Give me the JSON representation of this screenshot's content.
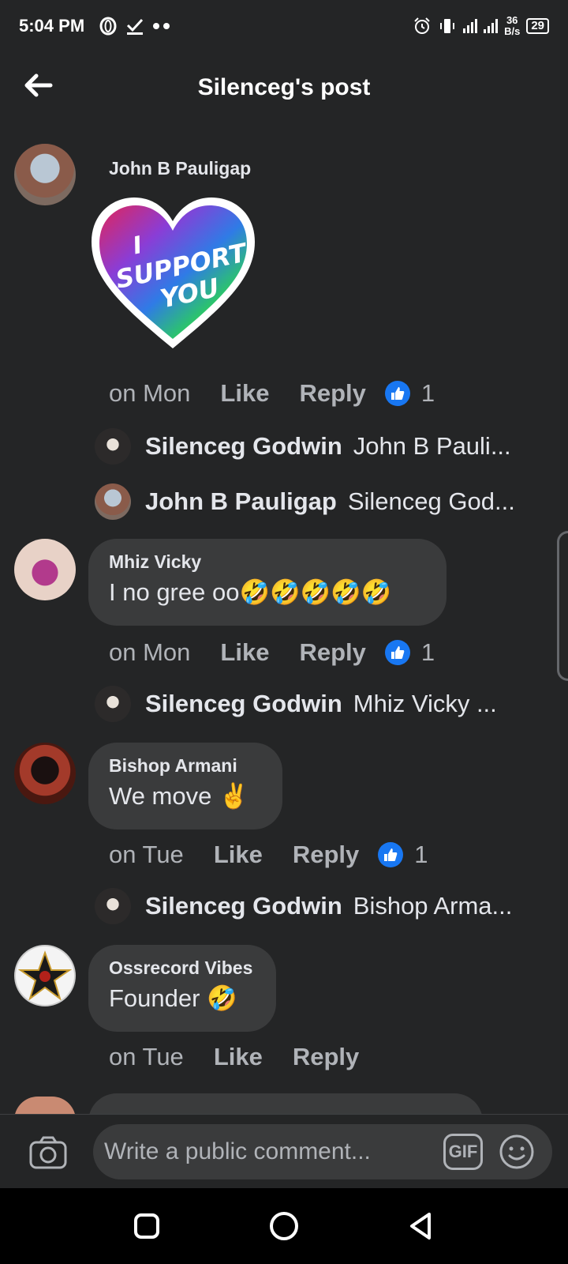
{
  "status_bar": {
    "time": "5:04 PM",
    "left_icons": [
      "opera-icon",
      "check-download-icon",
      "more-dots-icon"
    ],
    "network_speed_value": "36",
    "network_speed_unit": "B/s",
    "battery": "29"
  },
  "header": {
    "title": "Silenceg's post"
  },
  "comments": [
    {
      "name": "John B Pauligap",
      "sticker_text": "I SUPPORT YOU",
      "time": "on Mon",
      "like": "Like",
      "reply": "Reply",
      "reactions": "1",
      "replies": [
        {
          "name": "Silenceg Godwin",
          "text": "John B Pauli..."
        },
        {
          "name": "John B Pauligap",
          "text": "Silenceg God..."
        }
      ]
    },
    {
      "name": "Mhiz Vicky",
      "text": "I no gree oo🤣🤣🤣🤣🤣",
      "time": "on Mon",
      "like": "Like",
      "reply": "Reply",
      "reactions": "1",
      "replies": [
        {
          "name": "Silenceg Godwin",
          "text": "Mhiz Vicky ..."
        }
      ]
    },
    {
      "name": "Bishop Armani",
      "text": "We move ✌",
      "time": "on Tue",
      "like": "Like",
      "reply": "Reply",
      "reactions": "1",
      "replies": [
        {
          "name": "Silenceg Godwin",
          "text": "Bishop Arma..."
        }
      ]
    },
    {
      "name": "Ossrecord Vibes",
      "text": "Founder 🤣",
      "time": "on Tue",
      "like": "Like",
      "reply": "Reply"
    }
  ],
  "composer": {
    "placeholder": "Write a public comment...",
    "gif_label": "GIF"
  },
  "colors": {
    "background": "#242526",
    "bubble": "#3a3b3c",
    "text": "#e4e6eb",
    "muted": "#b0b3b8",
    "like_blue": "#1877f2"
  }
}
